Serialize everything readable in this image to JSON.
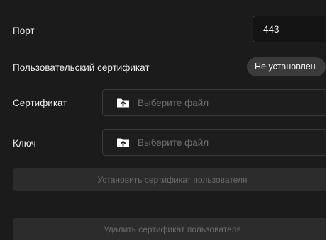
{
  "port": {
    "label": "Порт",
    "value": "443"
  },
  "user_certificate": {
    "label": "Пользовательский сертификат",
    "status": "Не установлен"
  },
  "certificate": {
    "label": "Сертификат",
    "placeholder": "Выберите файл",
    "icon": "folder-upload-icon"
  },
  "key": {
    "label": "Ключ",
    "placeholder": "Выберите файл",
    "icon": "folder-upload-icon"
  },
  "buttons": {
    "install": "Установить сертификат пользователя",
    "delete": "Удалить сертификат пользователя"
  },
  "colors": {
    "background": "#1b1b1b",
    "badge": "#3b3b3b",
    "button_disabled": "#2c2c2c",
    "text": "#ececec",
    "muted_text": "#6f6f6f"
  }
}
